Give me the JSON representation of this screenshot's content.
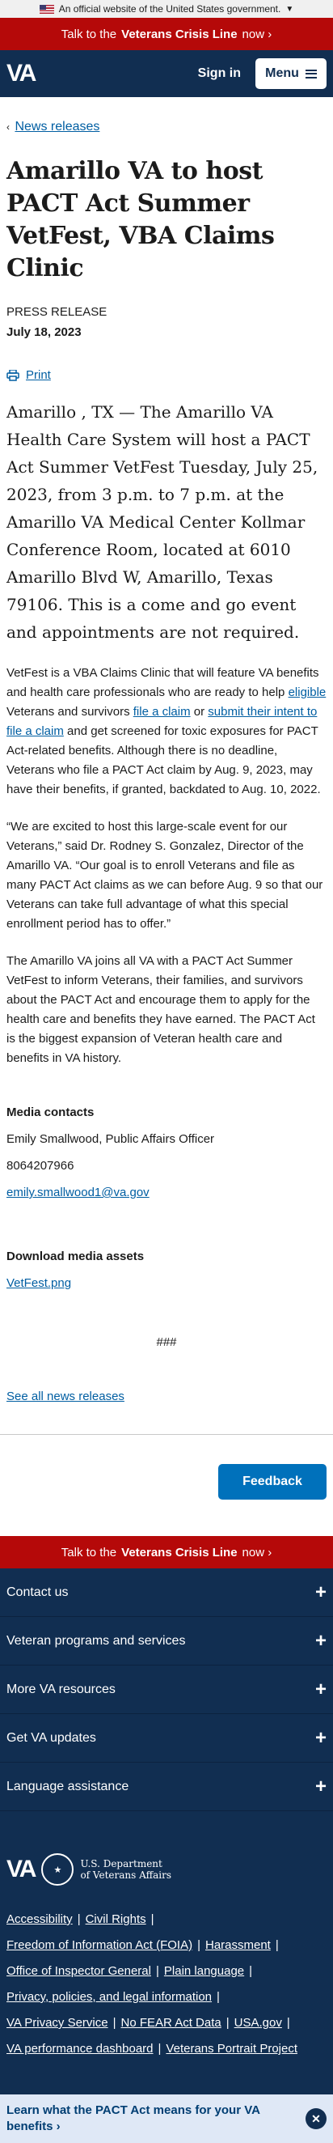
{
  "gov_banner": {
    "text": "An official website of the United States government."
  },
  "crisis": {
    "prefix": "Talk to the ",
    "strong": "Veterans Crisis Line",
    "suffix": " now  ›"
  },
  "header": {
    "logo": "VA",
    "signin": "Sign in",
    "menu": "Menu"
  },
  "breadcrumb": {
    "label": "News releases"
  },
  "article": {
    "title": "Amarillo VA to host PACT Act Summer VetFest, VBA Claims Clinic",
    "kicker": "PRESS RELEASE",
    "date": "July 18, 2023",
    "print": "Print",
    "lead": "Amarillo , TX — The Amarillo VA Health Care System will host a PACT Act Summer VetFest Tuesday, July 25, 2023, from 3 p.m. to 7 p.m. at the Amarillo VA Medical Center Kollmar Conference Room, located at 6010 Amarillo Blvd W, Amarillo, Texas 79106. This is a come and go event and appointments are not required.",
    "p1": {
      "a": "VetFest is a VBA Claims Clinic that will feature VA benefits and health care professionals who are ready to help ",
      "link1": "eligible",
      "b": " Veterans and survivors ",
      "link2": "file a claim",
      "c": " or ",
      "link3": "submit their intent to file a claim",
      "d": " and get screened for toxic exposures for PACT Act-related benefits. Although there is no deadline, Veterans who file a PACT Act claim by Aug. 9, 2023, may have their benefits, if granted, backdated to Aug. 10, 2022."
    },
    "p2": "“We are excited to host this large-scale event for our Veterans,” said Dr. Rodney S. Gonzalez, Director of the Amarillo VA. “Our goal is to enroll Veterans and file as many PACT Act claims as we can before Aug. 9 so that our Veterans can take full advantage of what this special enrollment period has to offer.”",
    "p3": "The Amarillo VA joins all VA with a PACT Act Summer VetFest to inform Veterans, their families, and survivors about the PACT Act and encourage them to apply for the health care and benefits they have earned. The PACT Act is the biggest expansion of Veteran health care and benefits in VA history.",
    "contacts_heading": "Media contacts",
    "contact_name": "Emily Smallwood, Public Affairs Officer",
    "contact_phone": "8064207966",
    "contact_email": "emily.smallwood1@va.gov",
    "assets_heading": "Download media assets",
    "asset_link": "VetFest.png",
    "end_mark": "###",
    "see_all": "See all news releases"
  },
  "feedback": "Feedback",
  "footer": {
    "accordions": [
      "Contact us",
      "Veteran programs and services",
      "More VA resources",
      "Get VA updates",
      "Language assistance"
    ],
    "logo": "VA",
    "dept": [
      "U.S. Department",
      "of Veterans Affairs"
    ],
    "links": [
      [
        "Accessibility",
        "Civil Rights"
      ],
      [
        "Freedom of Information Act (FOIA)",
        "Harassment"
      ],
      [
        "Office of Inspector General",
        "Plain language"
      ],
      [
        "Privacy, policies, and legal information"
      ],
      [
        "VA Privacy Service",
        "No FEAR Act Data",
        "USA.gov"
      ],
      [
        "VA performance dashboard",
        "Veterans Portrait Project"
      ]
    ]
  },
  "pact_banner": "Learn what the PACT Act means for your VA benefits ›",
  "colors": {
    "navy": "#112e51",
    "crisis_red": "#b50909",
    "link": "#005ea2",
    "feedback_blue": "#0071bb"
  }
}
